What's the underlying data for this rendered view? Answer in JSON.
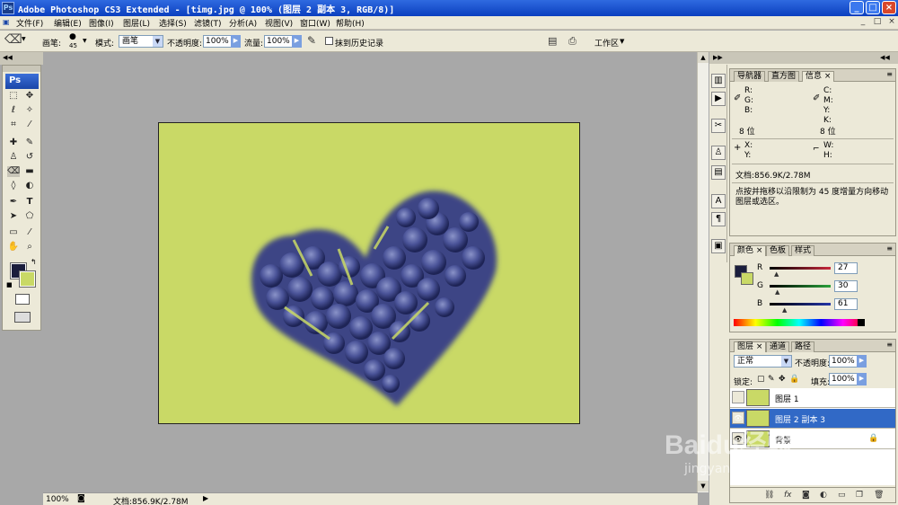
{
  "app": {
    "title": "Adobe Photoshop CS3 Extended - [timg.jpg @ 100% (图层 2 副本 3, RGB/8)]",
    "logo": "Ps"
  },
  "window_controls": {
    "minimize": "_",
    "maximize": "□",
    "close": "×"
  },
  "menu": [
    "文件(F)",
    "编辑(E)",
    "图像(I)",
    "图层(L)",
    "选择(S)",
    "滤镜(T)",
    "分析(A)",
    "视图(V)",
    "窗口(W)",
    "帮助(H)"
  ],
  "options": {
    "brush_label": "画笔:",
    "brush_size": "45",
    "mode_label": "模式:",
    "mode_value": "画笔",
    "opacity_label": "不透明度:",
    "opacity_value": "100%",
    "flow_label": "流量:",
    "flow_value": "100%",
    "history_label": "抹到历史记录",
    "workspace_label": "工作区"
  },
  "status": {
    "zoom": "100%",
    "doc": "文档:856.9K/2.78M"
  },
  "info_panel": {
    "tabs": [
      "导航器",
      "直方图",
      "信息"
    ],
    "active_tab": "信息",
    "r": "R:",
    "g": "G:",
    "b": "B:",
    "c": "C:",
    "m": "M:",
    "y": "Y:",
    "k": "K:",
    "bits_left": "8 位",
    "bits_right": "8 位",
    "x": "X:",
    "y_coord": "Y:",
    "w": "W:",
    "h": "H:",
    "doc": "文档:856.9K/2.78M",
    "hint": "点按并拖移以沿限制为 45 度增量方向移动图层或选区。"
  },
  "color_panel": {
    "tabs": [
      "颜色",
      "色板",
      "样式"
    ],
    "active_tab": "颜色",
    "channels": [
      {
        "label": "R",
        "value": "27",
        "fill": 0.106,
        "color": "#c8283c"
      },
      {
        "label": "G",
        "value": "30",
        "fill": 0.118,
        "color": "#2aa13a"
      },
      {
        "label": "B",
        "value": "61",
        "fill": 0.239,
        "color": "#2233a8"
      }
    ],
    "foreground": "#1b1e3d",
    "background": "#c9d966"
  },
  "layers_panel": {
    "tabs": [
      "图层",
      "通道",
      "路径"
    ],
    "active_tab": "图层",
    "blend_mode": "正常",
    "opacity_label": "不透明度:",
    "opacity_value": "100%",
    "lock_label": "锁定:",
    "fill_label": "填充:",
    "fill_value": "100%",
    "layers": [
      {
        "name": "图层 1",
        "visible": false,
        "selected": false
      },
      {
        "name": "图层 2 副本 3",
        "visible": true,
        "selected": true
      },
      {
        "name": "背景",
        "visible": true,
        "selected": false,
        "locked": true
      }
    ]
  },
  "watermark": {
    "text": "Baidu经验",
    "url": "jingyan.baidu.com"
  }
}
